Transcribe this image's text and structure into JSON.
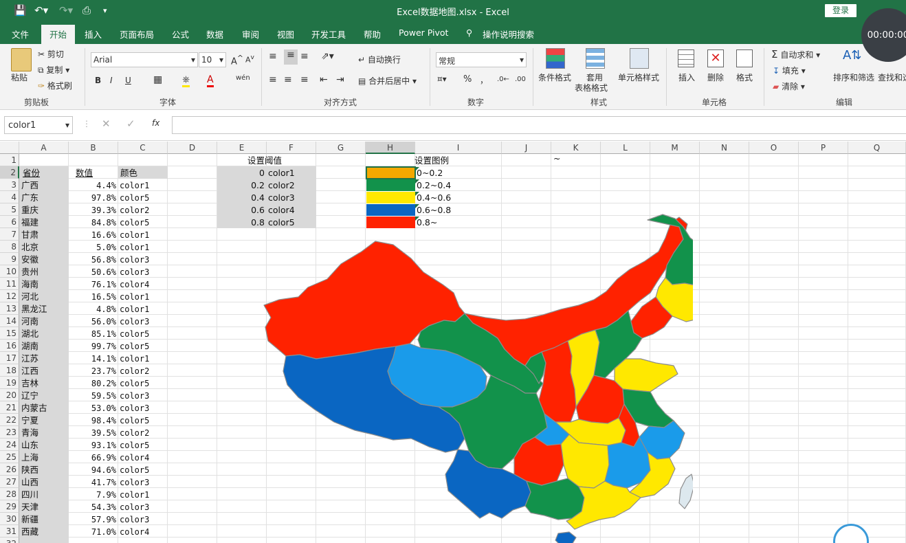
{
  "window": {
    "title": "Excel数据地图.xlsx  -  Excel",
    "login": "登录"
  },
  "timer": "00:00:00",
  "menu": [
    {
      "label": "文件"
    },
    {
      "label": "开始"
    },
    {
      "label": "插入"
    },
    {
      "label": "页面布局"
    },
    {
      "label": "公式"
    },
    {
      "label": "数据"
    },
    {
      "label": "审阅"
    },
    {
      "label": "视图"
    },
    {
      "label": "开发工具"
    },
    {
      "label": "帮助"
    },
    {
      "label": "Power Pivot"
    },
    {
      "label": "操作说明搜索"
    }
  ],
  "ribbon": {
    "clipboard": {
      "paste": "粘贴",
      "cut": "剪切",
      "copy": "复制",
      "painter": "格式刷",
      "group": "剪贴板"
    },
    "font": {
      "name": "Arial",
      "size": "10",
      "bold": "B",
      "italic": "I",
      "underline": "U",
      "phonetic": "wén",
      "group": "字体"
    },
    "align": {
      "wrap": "自动换行",
      "merge": "合并后居中",
      "group": "对齐方式"
    },
    "number": {
      "format": "常规",
      "percent": "%",
      "comma": "，",
      "group": "数字"
    },
    "styles": {
      "cond": "条件格式",
      "table1": "套用",
      "table2": "表格格式",
      "cell": "单元格样式",
      "group": "样式"
    },
    "cells": {
      "insert": "插入",
      "delete": "删除",
      "format": "格式",
      "group": "单元格"
    },
    "edit": {
      "autosum": "自动求和",
      "fill": "填充",
      "clear": "清除",
      "sort": "排序和筛选",
      "find": "查找和选",
      "group": "编辑"
    }
  },
  "formula": {
    "namebox": "color1",
    "fx": "fx"
  },
  "columns": [
    "A",
    "B",
    "C",
    "D",
    "E",
    "F",
    "G",
    "H",
    "I",
    "J",
    "K",
    "L",
    "M",
    "N",
    "O",
    "P",
    "Q"
  ],
  "header_row": {
    "a": "省份",
    "b": "数值",
    "c": "颜色"
  },
  "rows": [
    {
      "a": "广西",
      "b": "4.4%",
      "c": "color1"
    },
    {
      "a": "广东",
      "b": "97.8%",
      "c": "color5"
    },
    {
      "a": "重庆",
      "b": "39.3%",
      "c": "color2"
    },
    {
      "a": "福建",
      "b": "84.8%",
      "c": "color5"
    },
    {
      "a": "甘肃",
      "b": "16.6%",
      "c": "color1"
    },
    {
      "a": "北京",
      "b": "5.0%",
      "c": "color1"
    },
    {
      "a": "安徽",
      "b": "56.8%",
      "c": "color3"
    },
    {
      "a": "贵州",
      "b": "50.6%",
      "c": "color3"
    },
    {
      "a": "海南",
      "b": "76.1%",
      "c": "color4"
    },
    {
      "a": "河北",
      "b": "16.5%",
      "c": "color1"
    },
    {
      "a": "黑龙江",
      "b": "4.8%",
      "c": "color1"
    },
    {
      "a": "河南",
      "b": "56.0%",
      "c": "color3"
    },
    {
      "a": "湖北",
      "b": "85.1%",
      "c": "color5"
    },
    {
      "a": "湖南",
      "b": "99.7%",
      "c": "color5"
    },
    {
      "a": "江苏",
      "b": "14.1%",
      "c": "color1"
    },
    {
      "a": "江西",
      "b": "23.7%",
      "c": "color2"
    },
    {
      "a": "吉林",
      "b": "80.2%",
      "c": "color5"
    },
    {
      "a": "辽宁",
      "b": "59.5%",
      "c": "color3"
    },
    {
      "a": "内蒙古",
      "b": "53.0%",
      "c": "color3"
    },
    {
      "a": "宁夏",
      "b": "98.4%",
      "c": "color5"
    },
    {
      "a": "青海",
      "b": "39.5%",
      "c": "color2"
    },
    {
      "a": "山东",
      "b": "93.1%",
      "c": "color5"
    },
    {
      "a": "上海",
      "b": "66.9%",
      "c": "color4"
    },
    {
      "a": "陕西",
      "b": "94.6%",
      "c": "color5"
    },
    {
      "a": "山西",
      "b": "41.7%",
      "c": "color3"
    },
    {
      "a": "四川",
      "b": "7.9%",
      "c": "color1"
    },
    {
      "a": "天津",
      "b": "54.3%",
      "c": "color3"
    },
    {
      "a": "新疆",
      "b": "57.9%",
      "c": "color3"
    },
    {
      "a": "西藏",
      "b": "71.0%",
      "c": "color4"
    }
  ],
  "threshold": {
    "title": "设置阈值",
    "items": [
      {
        "value": "0",
        "name": "color1"
      },
      {
        "value": "0.2",
        "name": "color2"
      },
      {
        "value": "0.4",
        "name": "color3"
      },
      {
        "value": "0.6",
        "name": "color4"
      },
      {
        "value": "0.8",
        "name": "color5"
      }
    ]
  },
  "legend": {
    "title": "设置图例",
    "items": [
      {
        "label": "0~0.2",
        "color": "#f5a800"
      },
      {
        "label": "0.2~0.4",
        "color": "#12924b"
      },
      {
        "label": "0.4~0.6",
        "color": "#ffe800"
      },
      {
        "label": "0.6~0.8",
        "color": "#0a66c2"
      },
      {
        "label": "0.8~",
        "color": "#ff2200"
      }
    ]
  },
  "k1": "~",
  "colors": {
    "red": "#ff2200",
    "green": "#12924b",
    "yellow": "#ffe800",
    "blue": "#0a66c2",
    "light_blue": "#1a9bea",
    "excel_green": "#217346"
  }
}
